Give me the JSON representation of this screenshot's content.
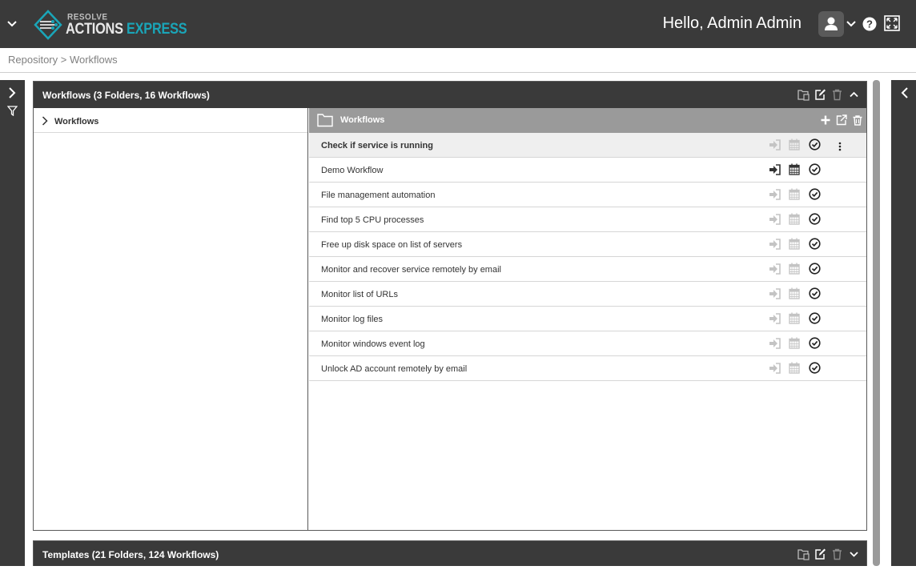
{
  "header": {
    "logo_line1": "RESOLVE",
    "logo_actions": "ACTIONS",
    "logo_express": "EXPRESS",
    "greeting": "Hello, Admin Admin"
  },
  "breadcrumb": "Repository > Workflows",
  "workflows_panel": {
    "title": "Workflows (3 Folders, 16 Workflows)",
    "tree_root": "Workflows",
    "list_title": "Workflows",
    "rows": [
      {
        "name": "Check if service is running",
        "selected": true,
        "active_icons": false
      },
      {
        "name": "Demo Workflow",
        "selected": false,
        "active_icons": true
      },
      {
        "name": "File management automation",
        "selected": false,
        "active_icons": false
      },
      {
        "name": "Find top 5 CPU processes",
        "selected": false,
        "active_icons": false
      },
      {
        "name": "Free up disk space on list of servers",
        "selected": false,
        "active_icons": false
      },
      {
        "name": "Monitor and recover service remotely by email",
        "selected": false,
        "active_icons": false
      },
      {
        "name": "Monitor list of URLs",
        "selected": false,
        "active_icons": false
      },
      {
        "name": "Monitor log files",
        "selected": false,
        "active_icons": false
      },
      {
        "name": "Monitor windows event log",
        "selected": false,
        "active_icons": false
      },
      {
        "name": "Unlock AD account remotely by email",
        "selected": false,
        "active_icons": false
      }
    ]
  },
  "templates_panel": {
    "title": "Templates (21 Folders, 124 Workflows)"
  },
  "colors": {
    "header_bg": "#3a3a3a",
    "accent": "#1aa5b8",
    "list_header_bg": "#9a9a9a",
    "icon_muted": "#c4c4c4",
    "icon_active": "#333333"
  },
  "icons": [
    "chevron-down-icon",
    "user-icon",
    "help-icon",
    "fullscreen-icon",
    "new-folder-icon",
    "edit-icon",
    "trash-icon",
    "chevron-up-icon",
    "folder-icon",
    "plus-icon",
    "external-link-icon",
    "run-icon",
    "calendar-icon",
    "check-circle-icon",
    "more-vertical-icon",
    "filter-icon",
    "chevron-right-icon",
    "chevron-left-icon"
  ]
}
